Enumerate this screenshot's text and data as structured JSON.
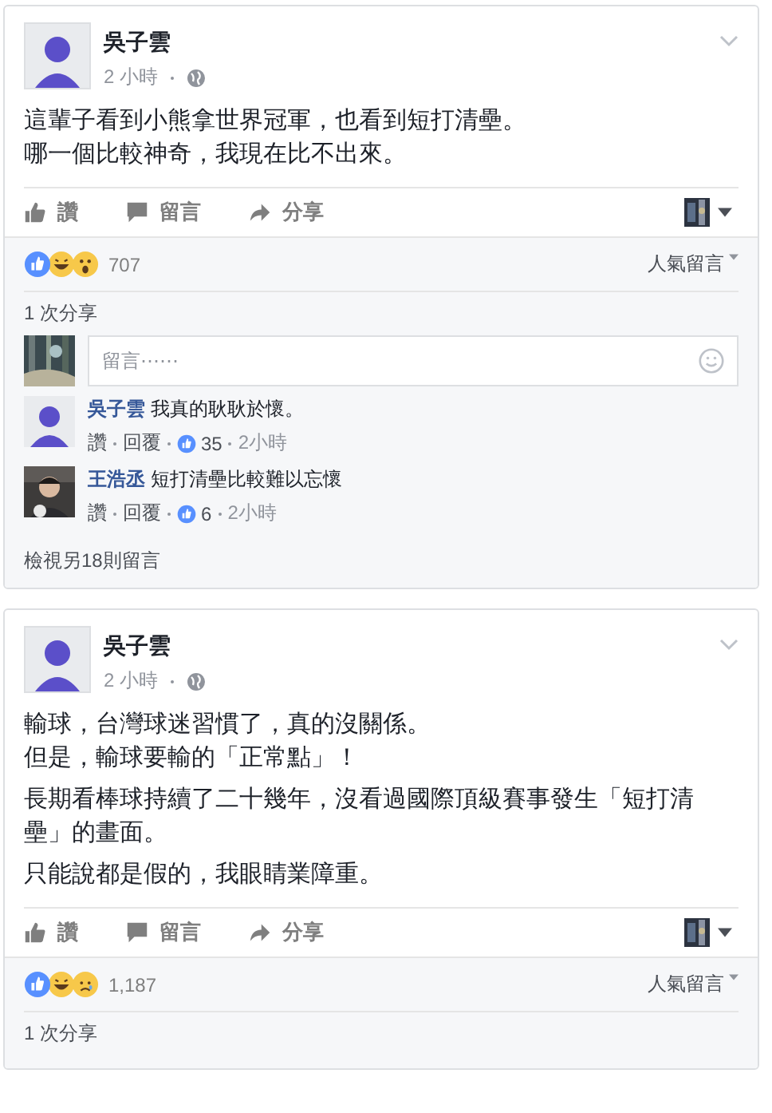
{
  "posts": [
    {
      "author": "吳子雲",
      "time": "2 小時",
      "paragraphs": [
        [
          "這輩子看到小熊拿世界冠軍，也看到短打清壘。",
          "哪一個比較神奇，我現在比不出來。"
        ]
      ],
      "actions": [
        {
          "kind": "like",
          "label": "讚"
        },
        {
          "kind": "comment",
          "label": "留言"
        },
        {
          "kind": "share",
          "label": "分享"
        }
      ],
      "reactions": [
        {
          "kind": "like"
        },
        {
          "kind": "haha"
        },
        {
          "kind": "wow"
        }
      ],
      "reaction_count": "707",
      "sort_label": "人氣留言",
      "shares": "1 次分享",
      "comment_box": {
        "placeholder": "留言⋯⋯"
      },
      "comments": [
        {
          "author": "吳子雲",
          "avatar": {
            "kind": "cartoon"
          },
          "text": "我真的耿耿於懷。",
          "like": "讚",
          "reply": "回覆",
          "likes": "35",
          "time": "2小時"
        },
        {
          "author": "王浩丞",
          "text": "短打清壘比較難以忘懷",
          "like": "讚",
          "reply": "回覆",
          "likes": "6",
          "time": "2小時"
        }
      ],
      "more_comments": "檢視另18則留言"
    },
    {
      "author": "吳子雲",
      "time": "2 小時",
      "paragraphs": [
        [
          "輸球，台灣球迷習慣了，真的沒關係。",
          "但是，輸球要輸的「正常點」！"
        ],
        [
          "長期看棒球持續了二十幾年，沒看過國際頂級賽事發生「短打清壘」的畫面。"
        ],
        [
          "只能說都是假的，我眼睛業障重。"
        ]
      ],
      "actions": [
        {
          "kind": "like",
          "label": "讚"
        },
        {
          "kind": "comment",
          "label": "留言"
        },
        {
          "kind": "share",
          "label": "分享"
        }
      ],
      "reactions": [
        {
          "kind": "like"
        },
        {
          "kind": "haha"
        },
        {
          "kind": "sad"
        }
      ],
      "reaction_count": "1,187",
      "sort_label": "人氣留言",
      "shares": "1 次分享"
    }
  ]
}
